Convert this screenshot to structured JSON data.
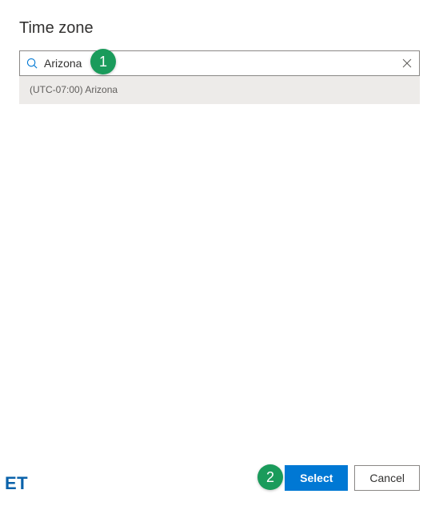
{
  "header": {
    "title": "Time zone"
  },
  "search": {
    "value": "Arizona"
  },
  "results": [
    {
      "label": "(UTC-07:00) Arizona"
    }
  ],
  "footer": {
    "select_label": "Select",
    "cancel_label": "Cancel"
  },
  "annotations": {
    "marker1": "1",
    "marker2": "2"
  },
  "watermark": "ET"
}
